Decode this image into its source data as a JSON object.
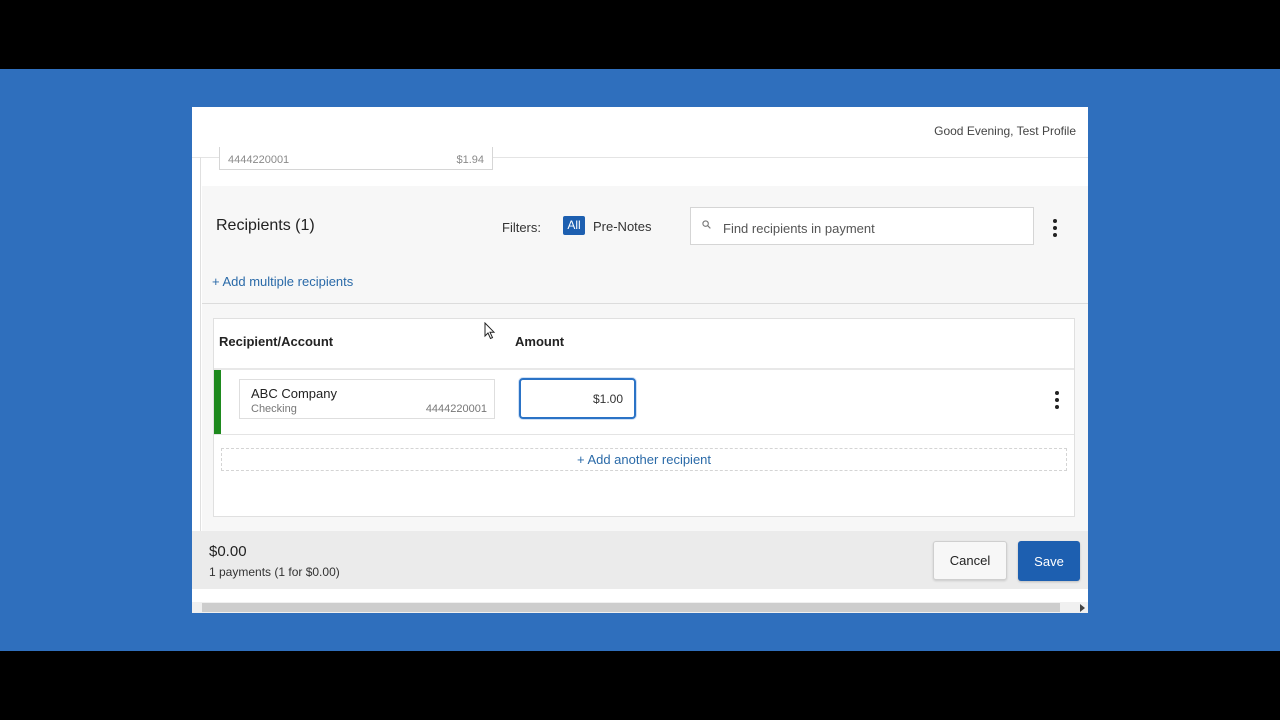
{
  "header": {
    "greeting": "Good Evening, Test Profile"
  },
  "previous_account": {
    "account_number": "4444220001",
    "amount": "$1.94"
  },
  "recipients": {
    "title": "Recipients (1)",
    "filters_label": "Filters:",
    "filter_all": "All",
    "filter_prenotes": "Pre-Notes",
    "search_placeholder": "Find recipients in payment",
    "add_multiple": "+ Add multiple recipients"
  },
  "table": {
    "headers": {
      "recipient": "Recipient/Account",
      "amount": "Amount"
    },
    "rows": [
      {
        "name": "ABC Company",
        "type": "Checking",
        "account": "4444220001",
        "amount": "$1.00",
        "status_color": "#1e8a1e"
      }
    ],
    "add_another": "+ Add another recipient"
  },
  "footer": {
    "total": "$0.00",
    "summary": "1 payments (1 for $0.00)",
    "cancel_label": "Cancel",
    "save_label": "Save"
  },
  "colors": {
    "brand_blue": "#1d5fb0",
    "background_blue": "#2f6fbd",
    "link": "#2a6aa8"
  }
}
